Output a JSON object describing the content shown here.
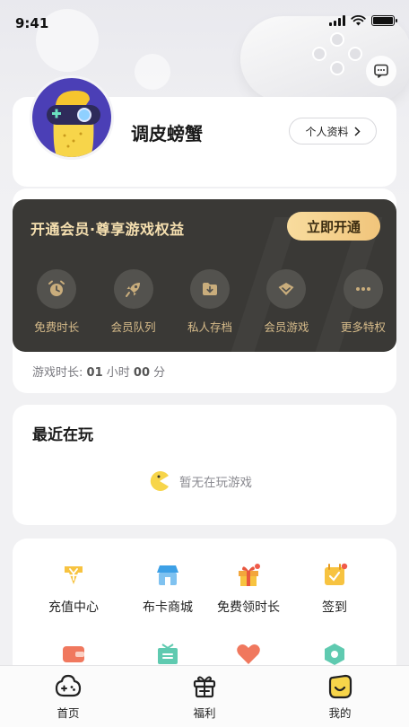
{
  "status_bar": {
    "time": "9:41"
  },
  "profile": {
    "name": "调皮螃蟹",
    "profile_button": "个人资料"
  },
  "vip": {
    "title": "开通会员·尊享游戏权益",
    "cta": "立即开通",
    "perks": [
      {
        "label": "免费时长",
        "icon": "alarm-clock-icon"
      },
      {
        "label": "会员队列",
        "icon": "rocket-icon"
      },
      {
        "label": "私人存档",
        "icon": "download-folder-icon"
      },
      {
        "label": "会员游戏",
        "icon": "diamond-icon"
      },
      {
        "label": "更多特权",
        "icon": "more-dots-icon"
      }
    ],
    "play_time_label": "游戏时长:",
    "play_time_hours": "01",
    "play_time_hours_unit": "小时",
    "play_time_minutes": "00",
    "play_time_minutes_unit": "分"
  },
  "recent": {
    "title": "最近在玩",
    "empty_text": "暂无在玩游戏"
  },
  "services": [
    {
      "label": "充值中心",
      "icon": "recharge-yen-icon"
    },
    {
      "label": "布卡商城",
      "icon": "store-icon"
    },
    {
      "label": "免费领时长",
      "icon": "gift-icon"
    },
    {
      "label": "签到",
      "icon": "check-in-calendar-icon"
    },
    {
      "label": "",
      "icon": "wallet-icon"
    },
    {
      "label": "",
      "icon": "exchange-box-icon"
    },
    {
      "label": "",
      "icon": "heart-icon"
    },
    {
      "label": "",
      "icon": "hexagon-icon"
    }
  ],
  "tabs": [
    {
      "label": "首页",
      "icon": "home-gamepad-icon"
    },
    {
      "label": "福利",
      "icon": "gift-box-icon"
    },
    {
      "label": "我的",
      "icon": "mine-face-icon"
    }
  ],
  "colors": {
    "vip_bg": "#3a3936",
    "vip_gold": "#f1c57b",
    "perk_text": "#d6bb8a",
    "accent_yellow": "#f7d54a",
    "accent_red": "#f05a4a"
  }
}
